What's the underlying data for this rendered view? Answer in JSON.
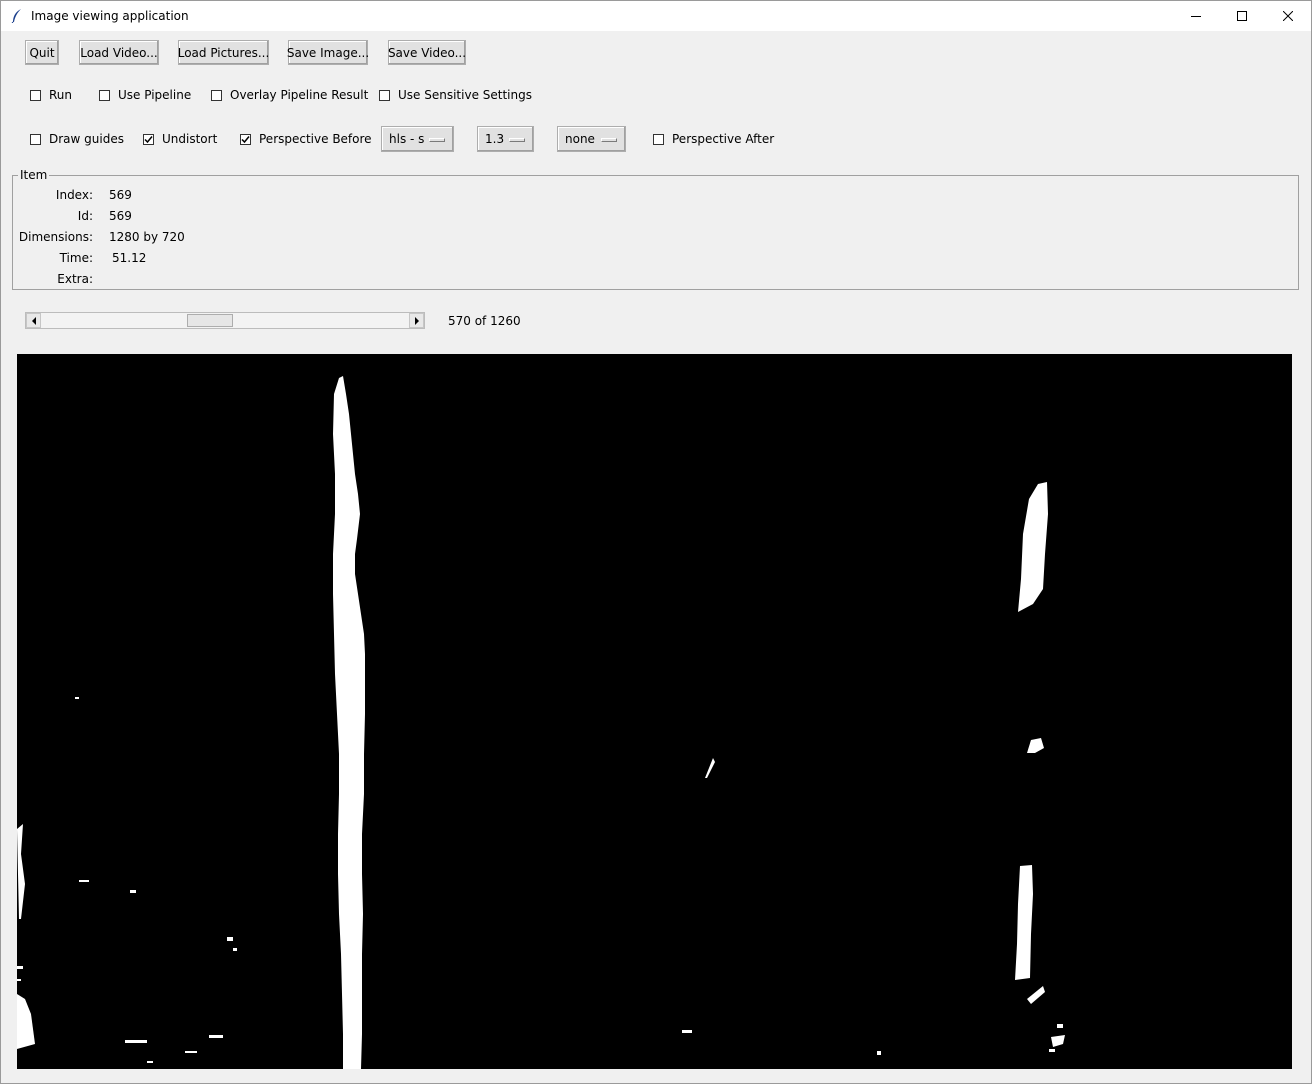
{
  "window": {
    "title": "Image viewing application",
    "icon": "feather-icon",
    "controls": [
      "minimize-icon",
      "maximize-icon",
      "close-icon"
    ]
  },
  "toolbar": {
    "quit": "Quit",
    "load_video": "Load Video...",
    "load_pictures": "Load Pictures...",
    "save_image": "Save Image...",
    "save_video": "Save Video..."
  },
  "options_row1": {
    "run": {
      "label": "Run",
      "checked": false
    },
    "use_pipeline": {
      "label": "Use Pipeline",
      "checked": false
    },
    "overlay_pipeline_result": {
      "label": "Overlay Pipeline Result",
      "checked": false
    },
    "use_sensitive_settings": {
      "label": "Use Sensitive Settings",
      "checked": false
    }
  },
  "options_row2": {
    "draw_guides": {
      "label": "Draw guides",
      "checked": false
    },
    "undistort": {
      "label": "Undistort",
      "checked": true
    },
    "perspective_before": {
      "label": "Perspective Before",
      "checked": true
    },
    "channel_select": "hls - s",
    "value_select": "1.3",
    "mode_select": "none",
    "perspective_after": {
      "label": "Perspective After",
      "checked": false
    }
  },
  "item": {
    "group_label": "Item",
    "index_label": "Index:",
    "index_value": "569",
    "id_label": "Id:",
    "id_value": "569",
    "dimensions_label": "Dimensions:",
    "dimensions_value": "1280 by 720",
    "time_label": "Time:",
    "time_value": "51.12",
    "extra_label": "Extra:",
    "extra_value": ""
  },
  "navigation": {
    "frame_counter": "570 of 1260",
    "position_fraction": 0.452
  },
  "colors": {
    "background": "#f0f0f0",
    "image_background": "#000000",
    "lane_pixels": "#ffffff"
  }
}
